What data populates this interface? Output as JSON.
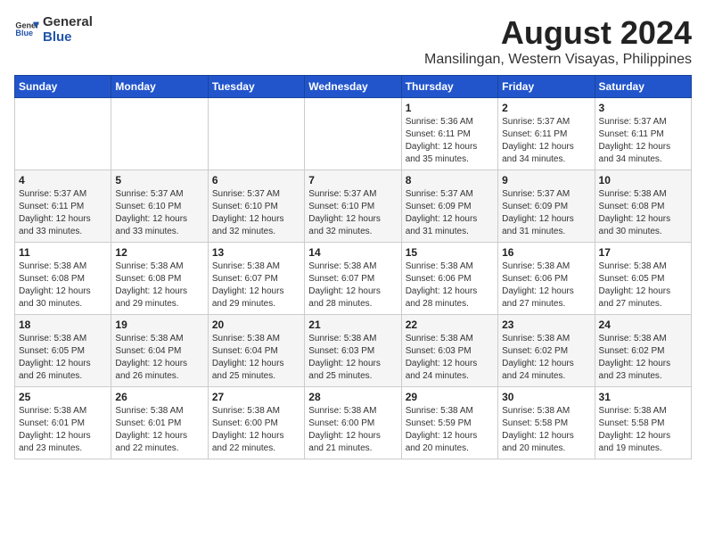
{
  "logo": {
    "general": "General",
    "blue": "Blue"
  },
  "title": "August 2024",
  "subtitle": "Mansilingan, Western Visayas, Philippines",
  "headers": [
    "Sunday",
    "Monday",
    "Tuesday",
    "Wednesday",
    "Thursday",
    "Friday",
    "Saturday"
  ],
  "weeks": [
    [
      {
        "day": "",
        "info": ""
      },
      {
        "day": "",
        "info": ""
      },
      {
        "day": "",
        "info": ""
      },
      {
        "day": "",
        "info": ""
      },
      {
        "day": "1",
        "info": "Sunrise: 5:36 AM\nSunset: 6:11 PM\nDaylight: 12 hours\nand 35 minutes."
      },
      {
        "day": "2",
        "info": "Sunrise: 5:37 AM\nSunset: 6:11 PM\nDaylight: 12 hours\nand 34 minutes."
      },
      {
        "day": "3",
        "info": "Sunrise: 5:37 AM\nSunset: 6:11 PM\nDaylight: 12 hours\nand 34 minutes."
      }
    ],
    [
      {
        "day": "4",
        "info": "Sunrise: 5:37 AM\nSunset: 6:11 PM\nDaylight: 12 hours\nand 33 minutes."
      },
      {
        "day": "5",
        "info": "Sunrise: 5:37 AM\nSunset: 6:10 PM\nDaylight: 12 hours\nand 33 minutes."
      },
      {
        "day": "6",
        "info": "Sunrise: 5:37 AM\nSunset: 6:10 PM\nDaylight: 12 hours\nand 32 minutes."
      },
      {
        "day": "7",
        "info": "Sunrise: 5:37 AM\nSunset: 6:10 PM\nDaylight: 12 hours\nand 32 minutes."
      },
      {
        "day": "8",
        "info": "Sunrise: 5:37 AM\nSunset: 6:09 PM\nDaylight: 12 hours\nand 31 minutes."
      },
      {
        "day": "9",
        "info": "Sunrise: 5:37 AM\nSunset: 6:09 PM\nDaylight: 12 hours\nand 31 minutes."
      },
      {
        "day": "10",
        "info": "Sunrise: 5:38 AM\nSunset: 6:08 PM\nDaylight: 12 hours\nand 30 minutes."
      }
    ],
    [
      {
        "day": "11",
        "info": "Sunrise: 5:38 AM\nSunset: 6:08 PM\nDaylight: 12 hours\nand 30 minutes."
      },
      {
        "day": "12",
        "info": "Sunrise: 5:38 AM\nSunset: 6:08 PM\nDaylight: 12 hours\nand 29 minutes."
      },
      {
        "day": "13",
        "info": "Sunrise: 5:38 AM\nSunset: 6:07 PM\nDaylight: 12 hours\nand 29 minutes."
      },
      {
        "day": "14",
        "info": "Sunrise: 5:38 AM\nSunset: 6:07 PM\nDaylight: 12 hours\nand 28 minutes."
      },
      {
        "day": "15",
        "info": "Sunrise: 5:38 AM\nSunset: 6:06 PM\nDaylight: 12 hours\nand 28 minutes."
      },
      {
        "day": "16",
        "info": "Sunrise: 5:38 AM\nSunset: 6:06 PM\nDaylight: 12 hours\nand 27 minutes."
      },
      {
        "day": "17",
        "info": "Sunrise: 5:38 AM\nSunset: 6:05 PM\nDaylight: 12 hours\nand 27 minutes."
      }
    ],
    [
      {
        "day": "18",
        "info": "Sunrise: 5:38 AM\nSunset: 6:05 PM\nDaylight: 12 hours\nand 26 minutes."
      },
      {
        "day": "19",
        "info": "Sunrise: 5:38 AM\nSunset: 6:04 PM\nDaylight: 12 hours\nand 26 minutes."
      },
      {
        "day": "20",
        "info": "Sunrise: 5:38 AM\nSunset: 6:04 PM\nDaylight: 12 hours\nand 25 minutes."
      },
      {
        "day": "21",
        "info": "Sunrise: 5:38 AM\nSunset: 6:03 PM\nDaylight: 12 hours\nand 25 minutes."
      },
      {
        "day": "22",
        "info": "Sunrise: 5:38 AM\nSunset: 6:03 PM\nDaylight: 12 hours\nand 24 minutes."
      },
      {
        "day": "23",
        "info": "Sunrise: 5:38 AM\nSunset: 6:02 PM\nDaylight: 12 hours\nand 24 minutes."
      },
      {
        "day": "24",
        "info": "Sunrise: 5:38 AM\nSunset: 6:02 PM\nDaylight: 12 hours\nand 23 minutes."
      }
    ],
    [
      {
        "day": "25",
        "info": "Sunrise: 5:38 AM\nSunset: 6:01 PM\nDaylight: 12 hours\nand 23 minutes."
      },
      {
        "day": "26",
        "info": "Sunrise: 5:38 AM\nSunset: 6:01 PM\nDaylight: 12 hours\nand 22 minutes."
      },
      {
        "day": "27",
        "info": "Sunrise: 5:38 AM\nSunset: 6:00 PM\nDaylight: 12 hours\nand 22 minutes."
      },
      {
        "day": "28",
        "info": "Sunrise: 5:38 AM\nSunset: 6:00 PM\nDaylight: 12 hours\nand 21 minutes."
      },
      {
        "day": "29",
        "info": "Sunrise: 5:38 AM\nSunset: 5:59 PM\nDaylight: 12 hours\nand 20 minutes."
      },
      {
        "day": "30",
        "info": "Sunrise: 5:38 AM\nSunset: 5:58 PM\nDaylight: 12 hours\nand 20 minutes."
      },
      {
        "day": "31",
        "info": "Sunrise: 5:38 AM\nSunset: 5:58 PM\nDaylight: 12 hours\nand 19 minutes."
      }
    ]
  ]
}
